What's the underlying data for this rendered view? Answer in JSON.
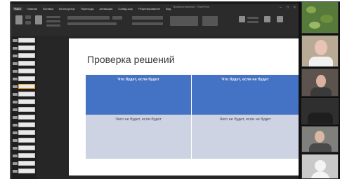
{
  "app": {
    "window_title": "Проверка решений - PowerPoint"
  },
  "menu": [
    {
      "label": "Файл",
      "active": true
    },
    {
      "label": "Главная",
      "active": false
    },
    {
      "label": "Вставка",
      "active": false
    },
    {
      "label": "Конструктор",
      "active": false
    },
    {
      "label": "Переходы",
      "active": false
    },
    {
      "label": "Анимация",
      "active": false
    },
    {
      "label": "Слайд-шоу",
      "active": false
    },
    {
      "label": "Рецензирование",
      "active": false
    },
    {
      "label": "Вид",
      "active": false
    }
  ],
  "slide": {
    "title": "Проверка решений",
    "table": {
      "headers": [
        "Что будет, если будет",
        "Что будет, если не будет"
      ],
      "rows": [
        [
          "Чего не будет, если будет",
          "Чего не будет, если не будет"
        ]
      ]
    }
  },
  "colors": {
    "table_header": "#4472c4",
    "table_body": "#cdd3e3",
    "app_background": "#1b1b1b"
  }
}
